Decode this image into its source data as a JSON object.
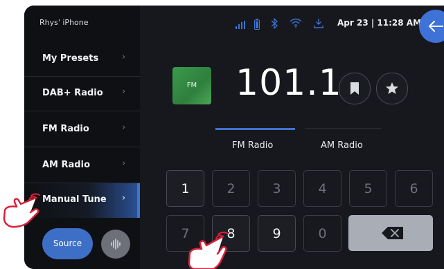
{
  "device_name": "Rhys' iPhone",
  "status": {
    "datetime": "Apr 23 | 11:28 AM"
  },
  "sidebar": {
    "items": [
      {
        "label": "My Presets"
      },
      {
        "label": "DAB+ Radio"
      },
      {
        "label": "FM Radio"
      },
      {
        "label": "AM Radio"
      },
      {
        "label": "Manual Tune",
        "active": true
      }
    ],
    "source_label": "Source"
  },
  "tuner": {
    "badge": "FM",
    "frequency": "101.1"
  },
  "tabs": [
    {
      "label": "FM Radio",
      "active": true
    },
    {
      "label": "AM Radio"
    }
  ],
  "keypad": {
    "row1": [
      "1",
      "2",
      "3",
      "4",
      "5",
      "6"
    ],
    "row2": [
      "7",
      "8",
      "9",
      "0"
    ],
    "enabled": [
      "1",
      "8",
      "9"
    ]
  },
  "icons": [
    "signal-icon",
    "battery-icon",
    "bluetooth-icon",
    "wifi-icon",
    "download-icon",
    "back-arrow-icon",
    "bookmark-icon",
    "star-icon",
    "sound-wave-icon",
    "backspace-icon",
    "hand-pointer-icon"
  ],
  "colors": {
    "accent": "#3e73d0",
    "fm_green": "#3a9a4e",
    "background": "#16181d"
  }
}
